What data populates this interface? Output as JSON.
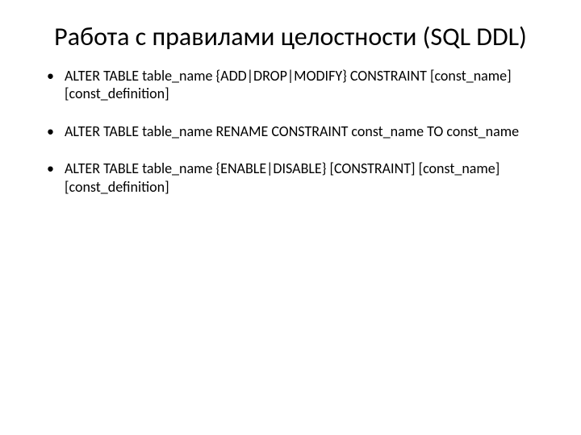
{
  "title": "Работа с правилами целостности (SQL DDL)",
  "bullets": [
    "ALTER TABLE table_name {ADD|DROP|MODIFY} CONSTRAINT [const_name] [const_definition]",
    "ALTER TABLE table_name RENAME CONSTRAINT const_name TO const_name",
    "ALTER TABLE table_name {ENABLE|DISABLE} [CONSTRAINT] [const_name] [const_definition]"
  ]
}
